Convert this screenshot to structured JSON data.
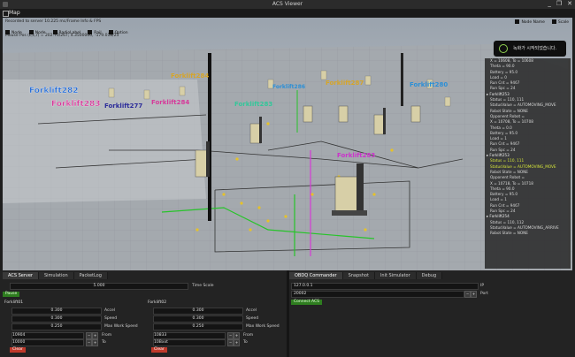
{
  "window": {
    "title": "ACS Viewer",
    "controls": [
      "_",
      "❐",
      "✕"
    ]
  },
  "map_panel": {
    "label": "Map"
  },
  "overlay": {
    "info_lines": [
      "Recorded to server 10.225 mc/Frame Info & FPS",
      "Mouse Pos (L,c,r) = 202.70/267; 4.3500000, -179.018/25"
    ],
    "checks": [
      "Node",
      "Node",
      "RadioLabel",
      "Rail",
      "Option"
    ],
    "right_checks": [
      "Node Name",
      "Scale"
    ]
  },
  "labels_3d": [
    {
      "text": "Forklift282",
      "color": "#2a6fd6"
    },
    {
      "text": "Forklift283",
      "color": "#d63a9a"
    },
    {
      "text": "Forklift277",
      "color": "#2c2c9a"
    },
    {
      "text": "Forklift284",
      "color": "#d6a52a"
    },
    {
      "text": "Forklift284",
      "color": "#d63a9a"
    },
    {
      "text": "Forklift286",
      "color": "#2c8fd6"
    },
    {
      "text": "Forklift287",
      "color": "#d6a52a"
    },
    {
      "text": "Forklift283",
      "color": "#33c79a"
    },
    {
      "text": "Forklift283",
      "color": "#cc33cc"
    },
    {
      "text": "Forklift280",
      "color": "#2c8fd6"
    }
  ],
  "notification": {
    "text": "녹화가 시작되었습니다."
  },
  "side_panel": {
    "rows": [
      {
        "text": "X = 10608, To = 10608",
        "type": "item"
      },
      {
        "text": "Theta = 90.0",
        "type": "item"
      },
      {
        "text": "Battery = 95.0",
        "type": "item"
      },
      {
        "text": "Load = 0",
        "type": "item"
      },
      {
        "text": "Run Cnt = 9467",
        "type": "item"
      },
      {
        "text": "Run Spc = 24",
        "type": "item"
      },
      {
        "text": "▸ Forklift253",
        "type": "grp"
      },
      {
        "text": "Status = 110, 111",
        "type": "item"
      },
      {
        "text": "StatusValue = AUTOMOVING_MOVE",
        "type": "item"
      },
      {
        "text": "Robot State = NONE",
        "type": "item"
      },
      {
        "text": "Opponent Robot = ",
        "type": "item"
      },
      {
        "text": "X = 10708, To = 10708",
        "type": "item"
      },
      {
        "text": "Theta = 0.0",
        "type": "item"
      },
      {
        "text": "Battery = 95.0",
        "type": "item"
      },
      {
        "text": "Load = 1",
        "type": "item"
      },
      {
        "text": "Run Cnt = 9467",
        "type": "item"
      },
      {
        "text": "Run Spc = 24",
        "type": "item"
      },
      {
        "text": "▸ Forklift253",
        "type": "grp"
      },
      {
        "text": "Status = 110, 111",
        "type": "hl"
      },
      {
        "text": "StatusValue = AUTOMOVING_MOVE",
        "type": "hl"
      },
      {
        "text": "Robot State = NONE",
        "type": "item"
      },
      {
        "text": "Opponent Robot = ",
        "type": "item"
      },
      {
        "text": "X = 10718, To = 10718",
        "type": "item"
      },
      {
        "text": "Theta = 90.0",
        "type": "item"
      },
      {
        "text": "Battery = 95.0",
        "type": "item"
      },
      {
        "text": "Load = 1",
        "type": "item"
      },
      {
        "text": "Run Cnt = 9467",
        "type": "item"
      },
      {
        "text": "Run Spc = 24",
        "type": "item"
      },
      {
        "text": "▸ Forklift254",
        "type": "grp"
      },
      {
        "text": "Status = 110, 112",
        "type": "item"
      },
      {
        "text": "StatusValue = AUTOMOVING_ARRIVE",
        "type": "item"
      },
      {
        "text": "Robot State = NONE",
        "type": "item"
      }
    ]
  },
  "bottom_left": {
    "tabs": [
      "ACS Server",
      "Simulation",
      "PacketLog"
    ],
    "time_scale_value": "5.000",
    "time_scale_label": "Time Scale",
    "pause_label": "Pause",
    "robots": [
      {
        "name": "Forklift01",
        "accel": "0.300",
        "accel_label": "Accel",
        "speed": "0.300",
        "speed_label": "Speed",
        "max_work": "0.250",
        "max_work_label": "Max Work Speed",
        "from": "10904",
        "from_label": "From",
        "to": "10000",
        "to_label": "To",
        "btn": "Clear"
      },
      {
        "name": "Forklift02",
        "accel": "0.300",
        "accel_label": "Accel",
        "speed": "0.300",
        "speed_label": "Speed",
        "max_work": "0.250",
        "max_work_label": "Max Work Speed",
        "from": "10833",
        "from_label": "From",
        "to": "10Bxxt",
        "to_label": "To",
        "btn": "Clear"
      }
    ]
  },
  "bottom_right": {
    "tabs": [
      "OBDQ Commander",
      "Snapshot",
      "Init Simulator",
      "Debug"
    ],
    "ip": "127.0.0.1",
    "ip_label": "IP",
    "port": "20002",
    "port_label": "Port",
    "connect_label": "Connect ACS"
  }
}
